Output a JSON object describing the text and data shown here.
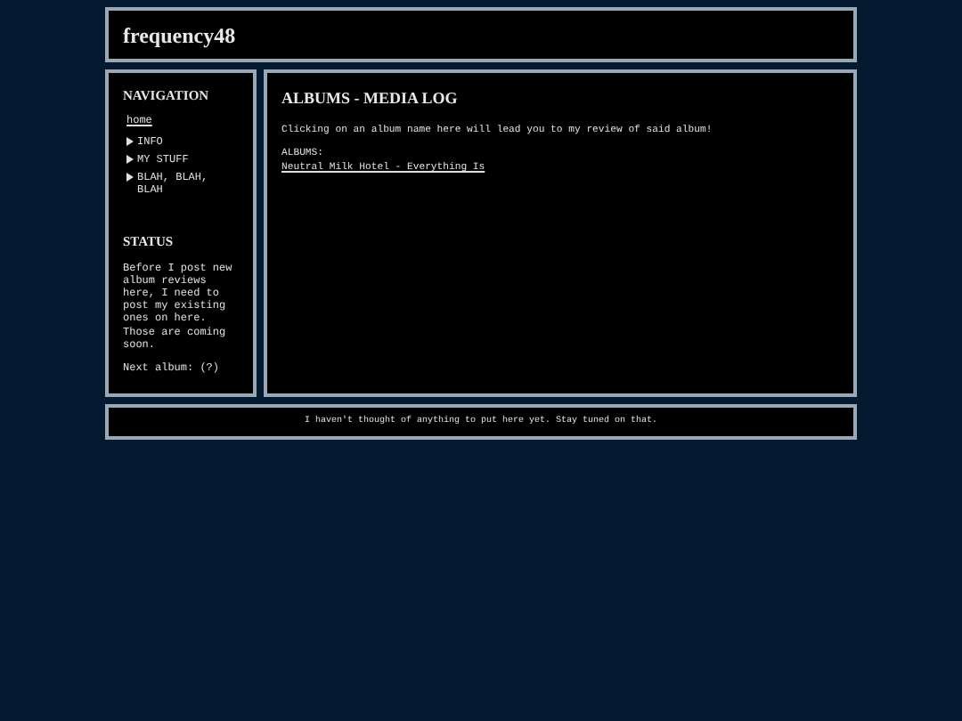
{
  "header": {
    "title": "frequency48"
  },
  "sidebar": {
    "navigation": {
      "heading": "NAVIGATION",
      "items": [
        {
          "label": "home",
          "kind": "link"
        },
        {
          "label": "INFO",
          "kind": "folder"
        },
        {
          "label": "MY STUFF",
          "kind": "folder"
        },
        {
          "label": "BLAH, BLAH, BLAH",
          "kind": "folder"
        }
      ]
    },
    "status": {
      "heading": "STATUS",
      "text": "Before I post new album reviews here, I need to post my existing ones on here. Those are coming soon.",
      "next": "Next album: (?)"
    }
  },
  "main": {
    "title": "ALBUMS - MEDIA LOG",
    "intro": "Clicking on an album name here will lead you to my review of said album!",
    "albums_label": "ALBUMS:",
    "albums": [
      "Neutral Milk Hotel - Everything Is"
    ]
  },
  "footer": {
    "text": "I haven't thought of anything to put here yet. Stay tuned on that."
  }
}
